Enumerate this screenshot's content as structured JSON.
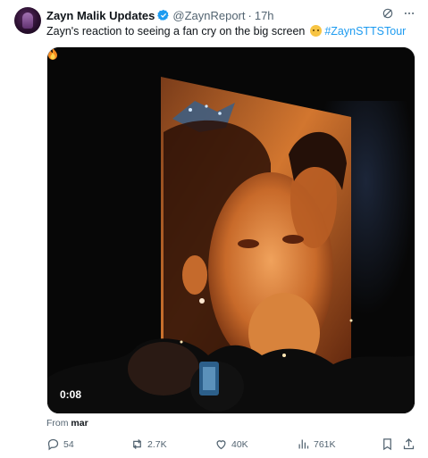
{
  "author": {
    "name": "Zayn Malik Updates",
    "handle": "@ZaynReport",
    "separator": "·",
    "time": "17h"
  },
  "tweet": {
    "text": "Zayn's reaction to seeing a fan cry on the big screen",
    "emoji": "🥹",
    "hashtag": "#ZaynSTTSTour"
  },
  "media": {
    "duration": "0:08"
  },
  "source": {
    "prefix": "From",
    "name": "mar"
  },
  "actions": {
    "replies": "54",
    "reposts": "2.7K",
    "likes": "40K",
    "views": "761K"
  },
  "colors": {
    "accent": "#1d9bf0",
    "text": "#0f1419",
    "muted": "#536471"
  },
  "icons": [
    "grok-icon",
    "more-icon",
    "verified-badge-icon",
    "reply-icon",
    "repost-icon",
    "like-icon",
    "views-icon",
    "bookmark-icon",
    "share-icon"
  ]
}
